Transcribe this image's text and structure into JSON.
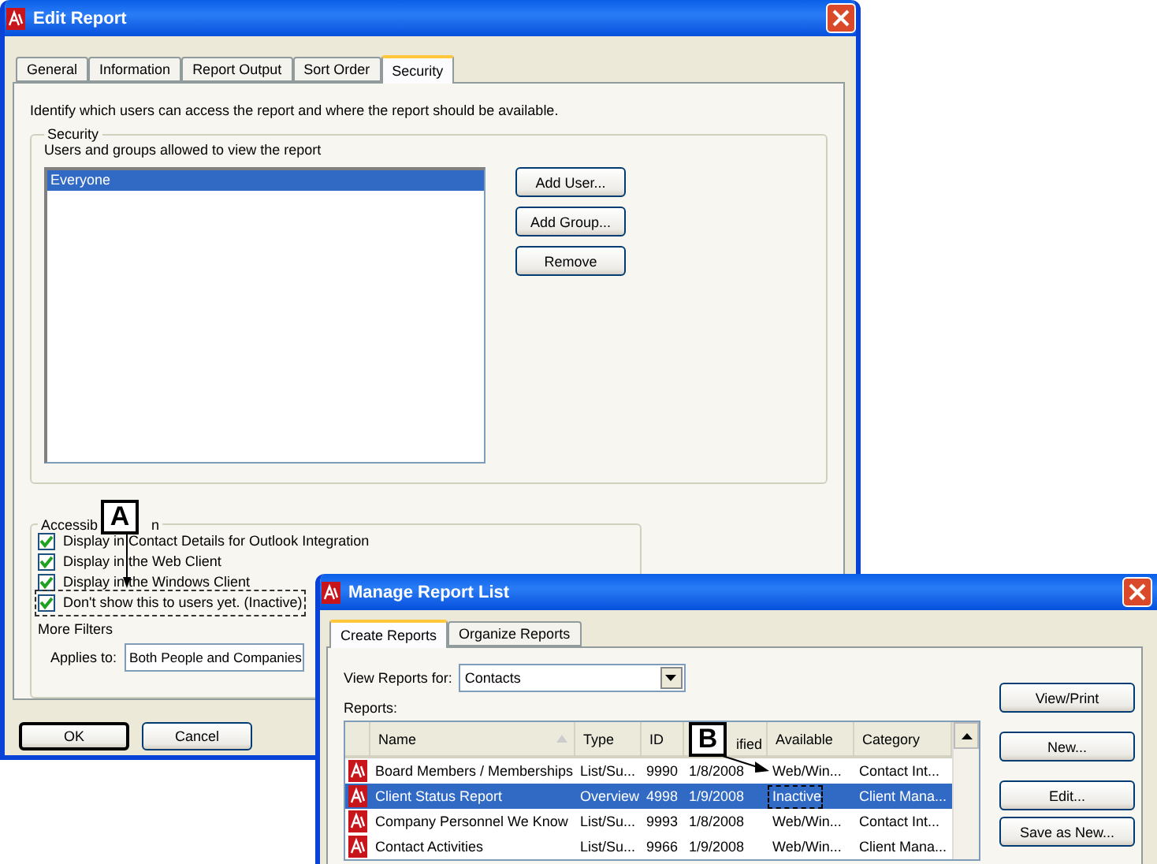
{
  "edit_report": {
    "title": "Edit Report",
    "tabs": [
      {
        "label": "General",
        "selected": false
      },
      {
        "label": "Information",
        "selected": false
      },
      {
        "label": "Report Output",
        "selected": false
      },
      {
        "label": "Sort Order",
        "selected": false
      },
      {
        "label": "Security",
        "selected": true
      }
    ],
    "description": "Identify which users can access the report and where the report should be available.",
    "security": {
      "legend": "Security",
      "hint": "Users and groups allowed to view the report",
      "users": [
        {
          "label": "Everyone",
          "selected": true
        }
      ],
      "buttons": [
        "Add User...",
        "Add Group...",
        "Remove"
      ]
    },
    "accessibility": {
      "legend_parts": [
        "Accessib",
        "n"
      ],
      "options": [
        {
          "label": "Display in Contact Details for Outlook Integration",
          "checked": true,
          "outlined": false
        },
        {
          "label": "Display in the Web Client",
          "checked": true,
          "outlined": false
        },
        {
          "label": "Display in the Windows Client",
          "checked": true,
          "outlined": false
        },
        {
          "label": "Don't show this to users yet. (Inactive)",
          "checked": true,
          "outlined": true
        }
      ],
      "more_filters": "More Filters",
      "applies_to_label": "Applies to:",
      "applies_to_value": "Both People and Companies"
    },
    "buttons": [
      "OK",
      "Cancel"
    ]
  },
  "callouts": [
    {
      "label": "A"
    },
    {
      "label": "B"
    }
  ],
  "manage_report_list": {
    "title": "Manage Report List",
    "tabs": [
      {
        "label": "Create Reports",
        "selected": true
      },
      {
        "label": "Organize Reports",
        "selected": false
      }
    ],
    "view_for_label": "View Reports for:",
    "view_for_value": "Contacts",
    "reports_label": "Reports:",
    "columns": [
      {
        "label": "Name",
        "kind": "sorted"
      },
      {
        "label": "Type",
        "kind": "plain"
      },
      {
        "label": "ID",
        "kind": "plain"
      },
      {
        "label": "ified",
        "kind": "partial"
      },
      {
        "label": "Available",
        "kind": "plain"
      },
      {
        "label": "Category",
        "kind": "plain"
      }
    ],
    "rows": [
      {
        "cells": [
          "Board Members / Memberships",
          "List/Su...",
          "9990",
          "1/8/2008",
          "Web/Win...",
          "Contact Int..."
        ],
        "selected": false,
        "outlined": false
      },
      {
        "cells": [
          "Client Status Report",
          "Overview",
          "4998",
          "1/9/2008",
          "Inactive",
          "Client Mana..."
        ],
        "selected": true,
        "outlined": true
      },
      {
        "cells": [
          "Company Personnel We Know",
          "List/Su...",
          "9993",
          "1/8/2008",
          "Web/Win...",
          "Contact Int..."
        ],
        "selected": false,
        "outlined": false
      },
      {
        "cells": [
          "Contact Activities",
          "List/Su...",
          "9966",
          "1/9/2008",
          "Web/Win...",
          "Client Mana..."
        ],
        "selected": false,
        "outlined": false
      }
    ],
    "buttons": [
      "View/Print",
      "New...",
      "Edit...",
      "Save as New..."
    ]
  }
}
